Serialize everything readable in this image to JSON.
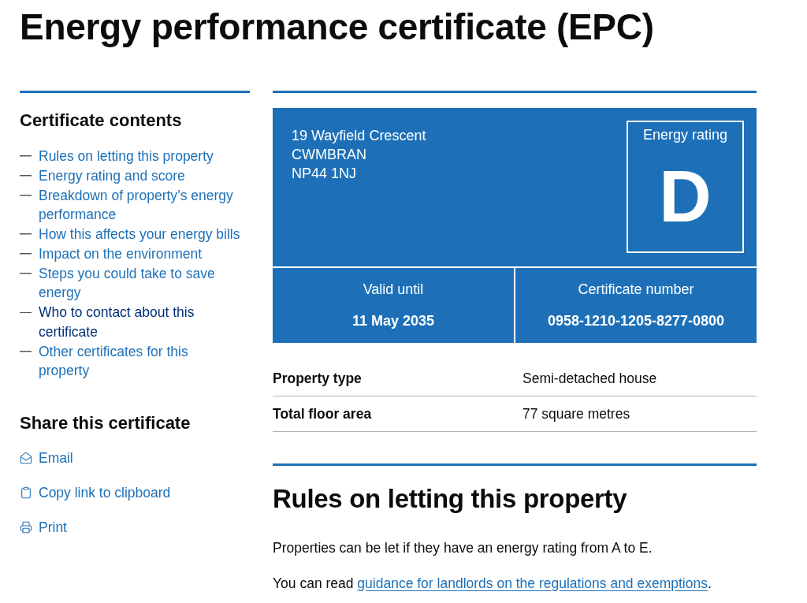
{
  "page": {
    "title": "Energy performance certificate (EPC)"
  },
  "sidebar": {
    "contents": {
      "heading": "Certificate contents",
      "items": [
        {
          "label": "Rules on letting this property",
          "hovered": false
        },
        {
          "label": "Energy rating and score",
          "hovered": false
        },
        {
          "label": "Breakdown of property’s energy performance",
          "hovered": false
        },
        {
          "label": "How this affects your energy bills",
          "hovered": false
        },
        {
          "label": "Impact on the environment",
          "hovered": false
        },
        {
          "label": "Steps you could take to save energy",
          "hovered": false
        },
        {
          "label": "Who to contact about this certificate",
          "hovered": true
        },
        {
          "label": "Other certificates for this property",
          "hovered": false
        }
      ]
    },
    "share": {
      "heading": "Share this certificate",
      "items": [
        {
          "label": "Email",
          "kind": "email"
        },
        {
          "label": "Copy link to clipboard",
          "kind": "clipboard"
        },
        {
          "label": "Print",
          "kind": "print"
        }
      ]
    }
  },
  "summary": {
    "address": [
      "19 Wayfield Crescent",
      "CWMBRAN",
      "NP44 1NJ"
    ],
    "rating": {
      "label": "Energy rating",
      "value": "D"
    },
    "facts": [
      {
        "label": "Valid until",
        "value": "11 May 2035"
      },
      {
        "label": "Certificate number",
        "value": "0958-1210-1205-8277-0800"
      }
    ]
  },
  "property_table": {
    "rows": [
      {
        "label": "Property type",
        "value": "Semi-detached house"
      },
      {
        "label": "Total floor area",
        "value": "77 square metres"
      }
    ]
  },
  "rules_section": {
    "heading": "Rules on letting this property",
    "paragraph": "Properties can be let if they have an energy rating from A to E.",
    "link_paragraph": {
      "before": "You can read ",
      "link": "guidance for landlords on the regulations and exemptions",
      "after": "."
    }
  }
}
